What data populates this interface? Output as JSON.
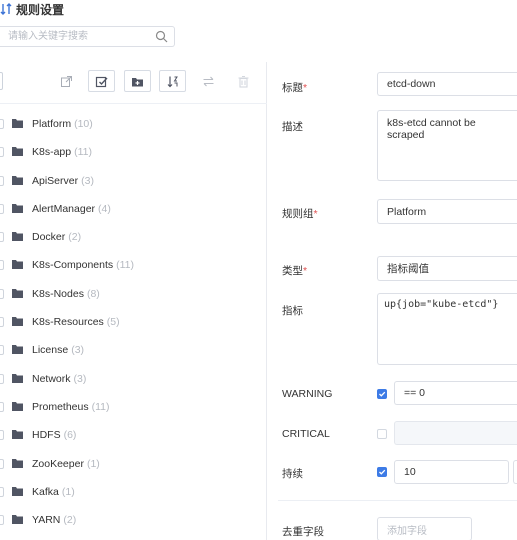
{
  "header": {
    "title": "规则设置",
    "icon": "filter-sort-icon"
  },
  "search": {
    "placeholder": "请输入关键字搜索"
  },
  "toolbar": {
    "buttons": [
      "export-icon",
      "edit-icon",
      "add-folder-icon",
      "sort-icon",
      "swap-icon",
      "delete-icon"
    ]
  },
  "tree": {
    "items": [
      {
        "label": "Platform",
        "count": "(10)"
      },
      {
        "label": "K8s-app",
        "count": "(11)"
      },
      {
        "label": "ApiServer",
        "count": "(3)"
      },
      {
        "label": "AlertManager",
        "count": "(4)"
      },
      {
        "label": "Docker",
        "count": "(2)"
      },
      {
        "label": "K8s-Components",
        "count": "(11)"
      },
      {
        "label": "K8s-Nodes",
        "count": "(8)"
      },
      {
        "label": "K8s-Resources",
        "count": "(5)"
      },
      {
        "label": "License",
        "count": "(3)"
      },
      {
        "label": "Network",
        "count": "(3)"
      },
      {
        "label": "Prometheus",
        "count": "(11)"
      },
      {
        "label": "HDFS",
        "count": "(6)"
      },
      {
        "label": "ZooKeeper",
        "count": "(1)"
      },
      {
        "label": "Kafka",
        "count": "(1)"
      },
      {
        "label": "YARN",
        "count": "(2)"
      }
    ]
  },
  "form": {
    "title_label": "标题",
    "title_value": "etcd-down",
    "desc_label": "描述",
    "desc_value": "k8s-etcd cannot be scraped",
    "group_label": "规则组",
    "group_value": "Platform",
    "type_label": "类型",
    "type_value": "指标阈值",
    "metric_label": "指标",
    "metric_value": "up{job=\"kube-etcd\"}",
    "warning_label": "WARNING",
    "warning_checked": true,
    "warning_value": "== 0",
    "critical_label": "CRITICAL",
    "critical_checked": false,
    "critical_value": "",
    "duration_label": "持续",
    "duration_checked": true,
    "duration_value": "10",
    "dedup_label": "去重字段",
    "dedup_placeholder": "添加字段",
    "required_mark": "*"
  },
  "colors": {
    "accent": "#3d7be6",
    "folder": "#505563",
    "border": "#dcdfe6"
  }
}
